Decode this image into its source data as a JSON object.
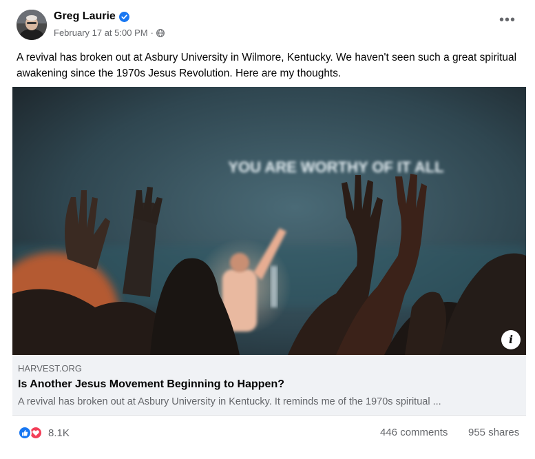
{
  "post": {
    "author": "Greg Laurie",
    "timestamp": "February 17 at 5:00 PM",
    "separator": "·",
    "text": "A revival has broken out at Asbury University in Wilmore, Kentucky. We haven't seen such a great spiritual awakening since the 1970s Jesus Revolution. Here are my thoughts.",
    "more_label": "•••"
  },
  "link": {
    "domain": "HARVEST.ORG",
    "title": "Is Another Jesus Movement Beginning to Happen?",
    "description": "A revival has broken out at Asbury University in Kentucky. It reminds me of the 1970s spiritual ...",
    "image_text": "YOU ARE WORTHY OF IT ALL",
    "info_label": "i"
  },
  "footer": {
    "reaction_count": "8.1K",
    "comments": "446 comments",
    "shares": "955 shares"
  },
  "icons": {
    "verified": "verified-badge-icon",
    "privacy": "globe-icon",
    "reactions": [
      "like-icon",
      "love-icon"
    ]
  },
  "colors": {
    "accent": "#1877f2",
    "love": "#f33e58",
    "secondary_text": "#65676b",
    "link_card_bg": "#f0f2f5"
  }
}
